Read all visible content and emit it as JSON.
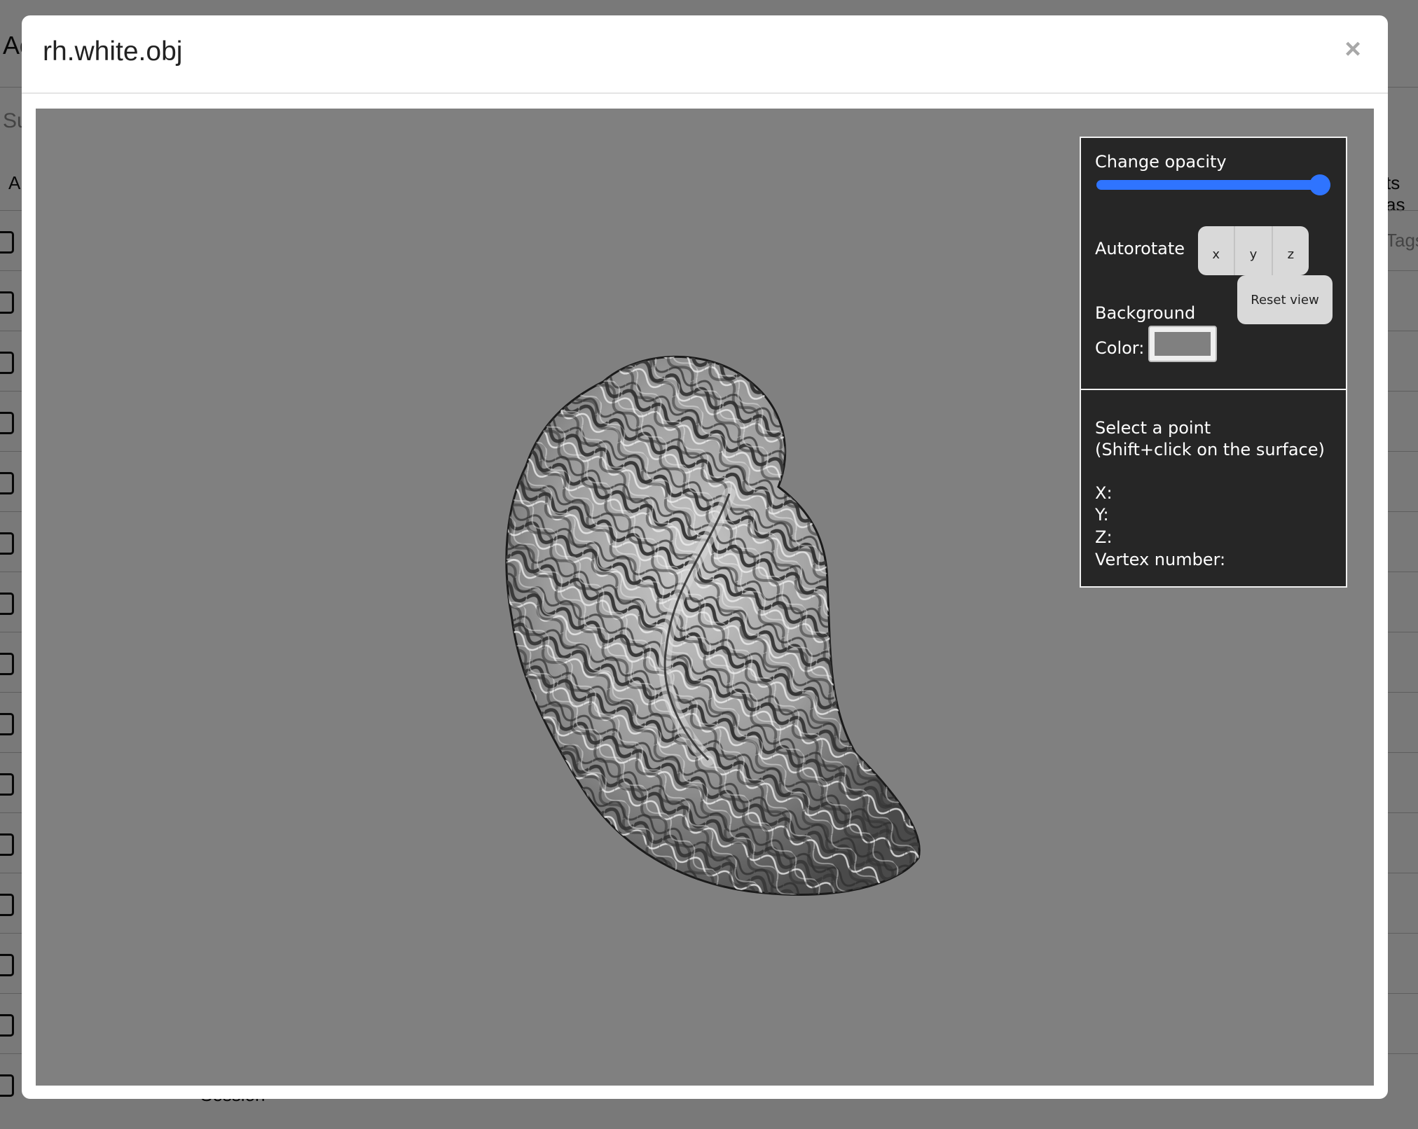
{
  "modal": {
    "title": "rh.white.obj",
    "close_label": "×"
  },
  "background_page": {
    "fragments": [
      "Ad",
      "Su",
      "A",
      "ts as",
      "Tags",
      "Session"
    ]
  },
  "controls": {
    "opacity_label": "Change opacity",
    "opacity_value": 1.0,
    "autorotate_label": "Autorotate",
    "axes": [
      "x",
      "y",
      "z"
    ],
    "reset_label": "Reset view",
    "background_label": "Background",
    "color_label": "Color:",
    "background_color": "#808080",
    "slider_color": "#2f74ff"
  },
  "point_info": {
    "title": "Select a point",
    "hint": "(Shift+click on the surface)",
    "x_label": "X:",
    "y_label": "Y:",
    "z_label": "Z:",
    "vertex_label": "Vertex number:"
  }
}
